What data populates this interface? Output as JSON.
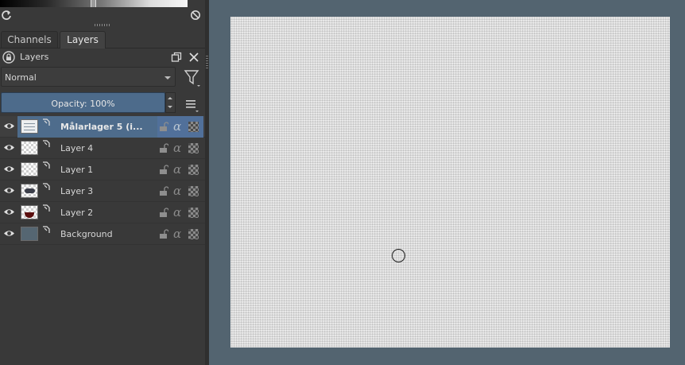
{
  "docker": {
    "tabs": [
      {
        "label": "Channels",
        "active": false
      },
      {
        "label": "Layers",
        "active": true
      }
    ],
    "title": "Layers",
    "blend_mode": "Normal",
    "opacity_label": "Opacity:  100%"
  },
  "layers": [
    {
      "name": "Målarlager 5 (i...",
      "selected": true,
      "thumb": "paint",
      "visible": true
    },
    {
      "name": "Layer 4",
      "selected": false,
      "thumb": "empty",
      "visible": true
    },
    {
      "name": "Layer 1",
      "selected": false,
      "thumb": "empty",
      "visible": true
    },
    {
      "name": "Layer 3",
      "selected": false,
      "thumb": "figure",
      "visible": true
    },
    {
      "name": "Layer 2",
      "selected": false,
      "thumb": "stroke",
      "visible": true
    },
    {
      "name": "Background",
      "selected": false,
      "thumb": "background",
      "visible": true
    }
  ],
  "colors": {
    "accent": "#4e6c8c",
    "canvas_bg": "#536470",
    "panel_bg": "#393939"
  },
  "icons": {
    "reset": "refresh-icon",
    "clear": "no-entry-icon",
    "filter": "funnel-icon",
    "menu": "hamburger-menu-icon",
    "float": "float-window-icon",
    "close": "close-icon"
  }
}
